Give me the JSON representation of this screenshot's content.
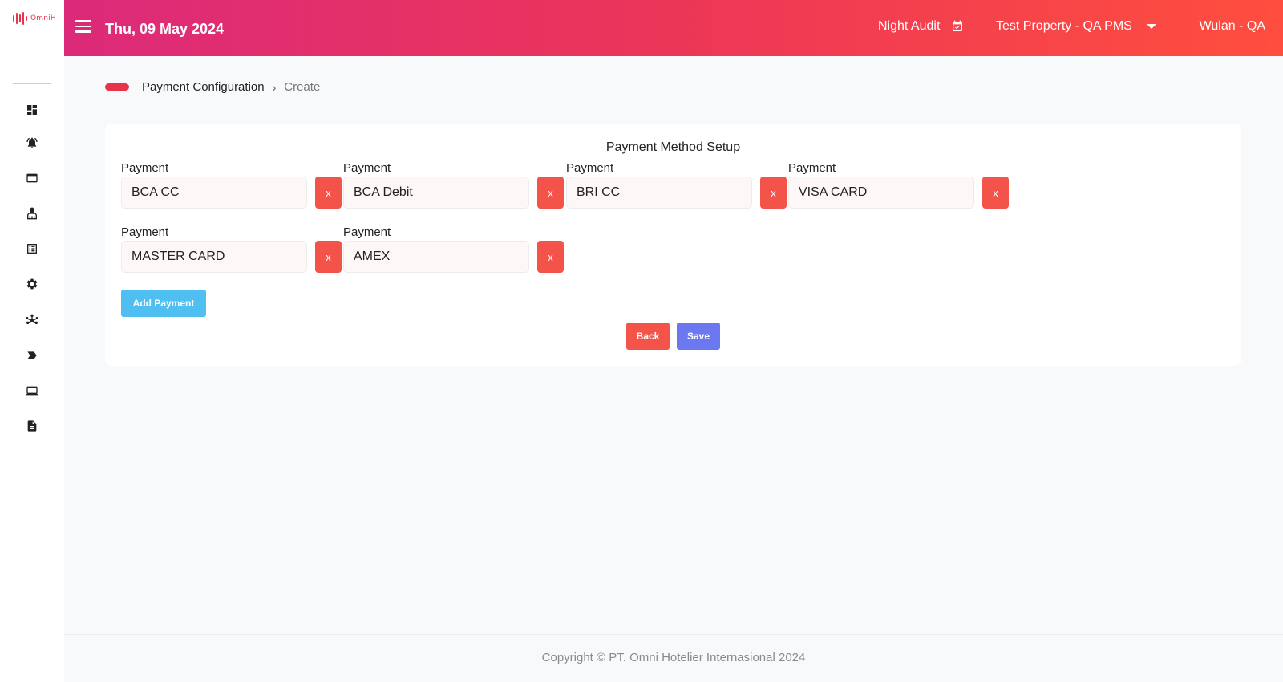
{
  "brand": {
    "logo_text": "OmniH",
    "accent_color": "#e8334a"
  },
  "sidebar": {
    "icons": [
      "dashboard-icon",
      "notification-bell-icon",
      "window-icon",
      "cleaning-icon",
      "list-icon",
      "settings-gear-icon",
      "network-icon",
      "arrow-label-icon",
      "laptop-icon",
      "report-icon"
    ]
  },
  "header": {
    "date": "Thu, 09 May 2024",
    "night_audit_label": "Night Audit",
    "property_label": "Test Property - QA PMS",
    "user_label": "Wulan - QA"
  },
  "breadcrumb": {
    "parent": "Payment Configuration",
    "current": "Create"
  },
  "form": {
    "title": "Payment Method Setup",
    "payments": [
      {
        "label": "Payment",
        "value": "BCA CC",
        "remove_label": "x"
      },
      {
        "label": "Payment",
        "value": "BCA Debit",
        "remove_label": "x"
      },
      {
        "label": "Payment",
        "value": "BRI CC",
        "remove_label": "x"
      },
      {
        "label": "Payment",
        "value": "VISA CARD",
        "remove_label": "x"
      },
      {
        "label": "Payment",
        "value": "MASTER CARD",
        "remove_label": "x"
      },
      {
        "label": "Payment",
        "value": "AMEX",
        "remove_label": "x"
      }
    ],
    "add_label": "Add Payment",
    "back_label": "Back",
    "save_label": "Save"
  },
  "footer": {
    "copyright": "Copyright © PT. Omni Hotelier Internasional 2024"
  }
}
